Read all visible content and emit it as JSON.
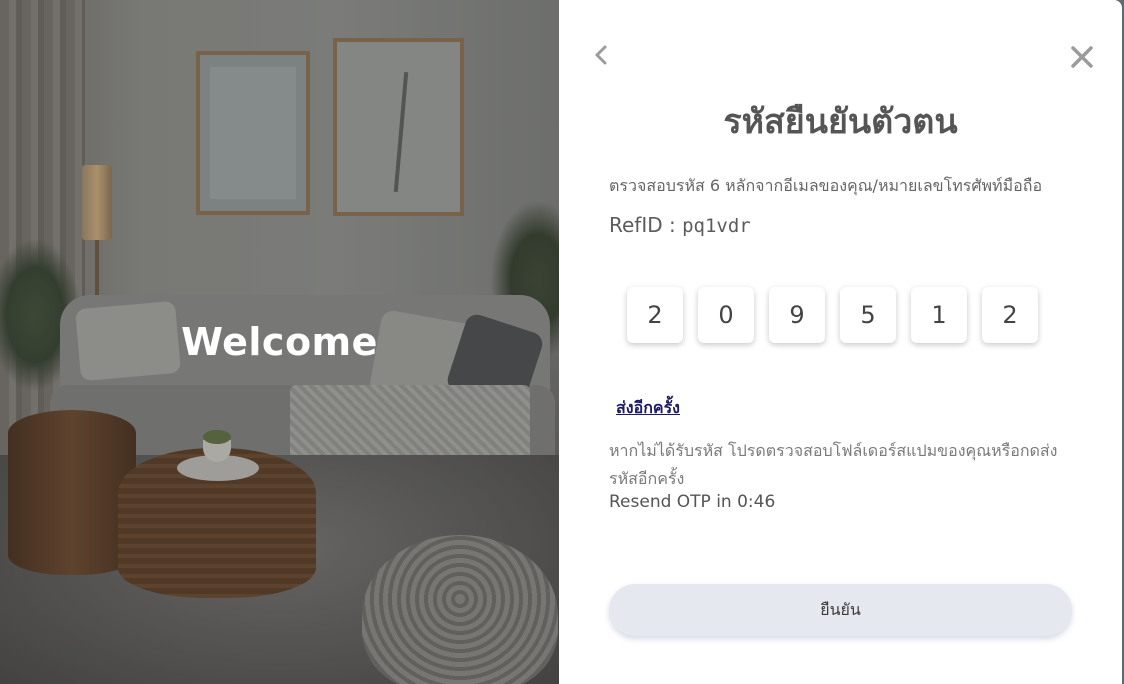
{
  "welcome_panel": {
    "heading": "Welcome"
  },
  "otp_dialog": {
    "back_icon": "chevron-left-icon",
    "close_icon": "close-icon",
    "title": "รหัสยืนยันตัวตน",
    "instruction": "ตรวจสอบรหัส 6 หลักจากอีเมลของคุณ/หมายเลขโทรศัพท์มือถือ",
    "ref_label": "RefID : ",
    "ref_value": "pq1vdr",
    "otp_digits": [
      "2",
      "0",
      "9",
      "5",
      "1",
      "2"
    ],
    "resend_link": "ส่งอีกครั้ง",
    "help_text": "หากไม่ได้รับรหัส โปรดตรวจสอบโฟล์เดอร์สแปมของคุณหรือกดส่งรหัสอีกครั้ง",
    "timer_text": "Resend OTP in 0:46",
    "confirm_button": "ยืนยัน"
  },
  "colors": {
    "title": "#555555",
    "link": "#1d1a66",
    "button_bg": "#e5e8ee",
    "card_bg": "#ffffff"
  }
}
